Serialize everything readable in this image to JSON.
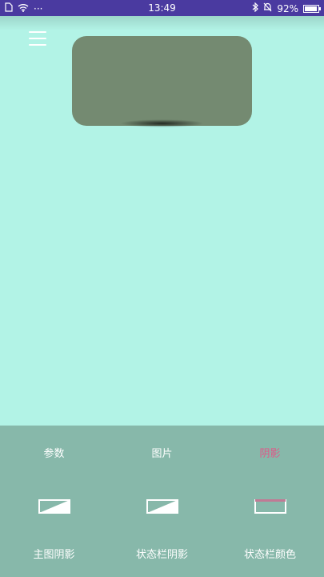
{
  "status_bar": {
    "time": "13:49",
    "battery": "92%",
    "dots": "···"
  },
  "bottom_panel": {
    "tabs": [
      {
        "label": "参数"
      },
      {
        "label": "图片"
      },
      {
        "label": "阴影",
        "active": true
      }
    ],
    "options": [
      {
        "label": "主图阴影",
        "icon": "main-shadow-icon"
      },
      {
        "label": "状态栏阴影",
        "icon": "statusbar-shadow-icon"
      },
      {
        "label": "状态栏颜色",
        "icon": "statusbar-color-icon"
      }
    ]
  },
  "colors": {
    "background": "#b2f3e6",
    "status_bar": "#4a3aa0",
    "card": "#748a71",
    "panel": "#87b8aa",
    "accent": "#e25586"
  }
}
